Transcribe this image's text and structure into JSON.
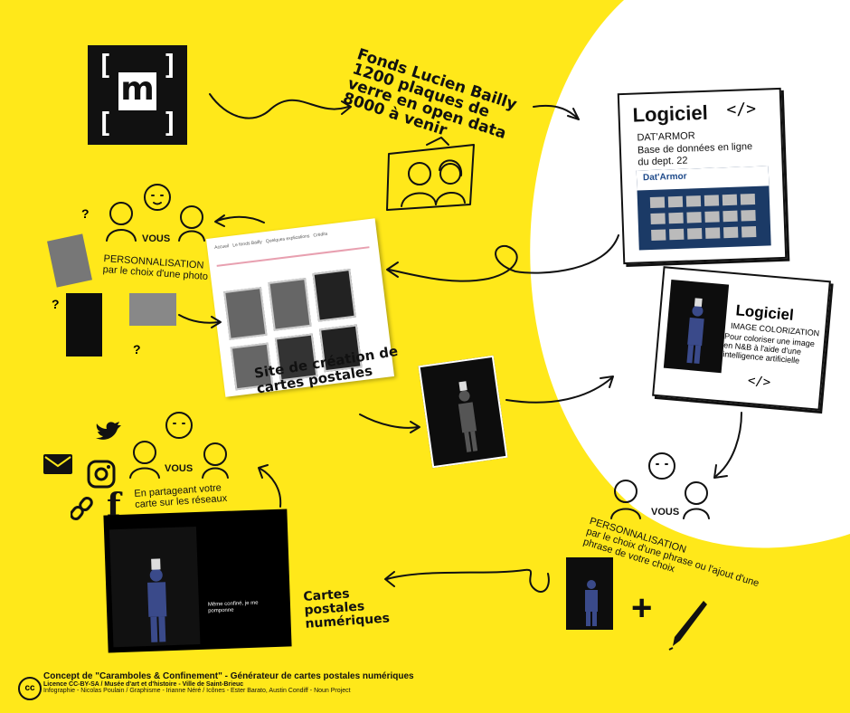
{
  "logo": {
    "letter": "m",
    "bracket_left": "[",
    "bracket_right": "]"
  },
  "fonds": {
    "line1": "Fonds Lucien Bailly",
    "line2": "1200 plaques de",
    "line3": "verre en open data",
    "line4": "8000 à venir"
  },
  "datarmor": {
    "title": "Logiciel",
    "code": "</>",
    "name": "DAT'ARMOR",
    "desc": "Base de données en ligne du dept. 22",
    "brand": "Dat'Armor"
  },
  "colorization": {
    "title": "Logiciel",
    "name": "IMAGE COLORIZATION",
    "desc": "Pour coloriser une image en N&B à l'aide d'une intelligence artificielle",
    "code": "</>"
  },
  "perso1": {
    "vous": "VOUS",
    "title": "PERSONNALISATION",
    "desc": "par le choix d'une photo",
    "q": "?"
  },
  "site": {
    "nav": [
      "Accueil",
      "Le fonds Bailly",
      "Quelques explications",
      "Crédits"
    ],
    "label_line1": "Site de création de",
    "label_line2": "cartes postales"
  },
  "share": {
    "vous": "VOUS",
    "line1": "En partageant votre",
    "line2": "carte sur les réseaux"
  },
  "postcard": {
    "message": "Même confiné, je me pomponne"
  },
  "cartes": {
    "line1": "Cartes",
    "line2": "postales",
    "line3": "numériques"
  },
  "perso2": {
    "vous": "VOUS",
    "title": "PERSONNALISATION",
    "desc": "par le choix d'une phrase ou l'ajout d'une phrase de votre choix",
    "plus": "+"
  },
  "footer": {
    "cc": "cc",
    "line1": "Concept de \"Caramboles & Confinement\" - Générateur de cartes postales numériques",
    "line2": "Licence CC-BY-SA / Musée d'art et d'histoire - Ville de Saint-Brieuc",
    "line3": "Infographie - Nicolas Poulain / Graphisme - Irianne Néré / Icônes - Ester Barato, Austin Condiff - Noun Project"
  },
  "colors": {
    "background": "#ffe81a",
    "ink": "#111111",
    "paper": "#ffffff"
  }
}
